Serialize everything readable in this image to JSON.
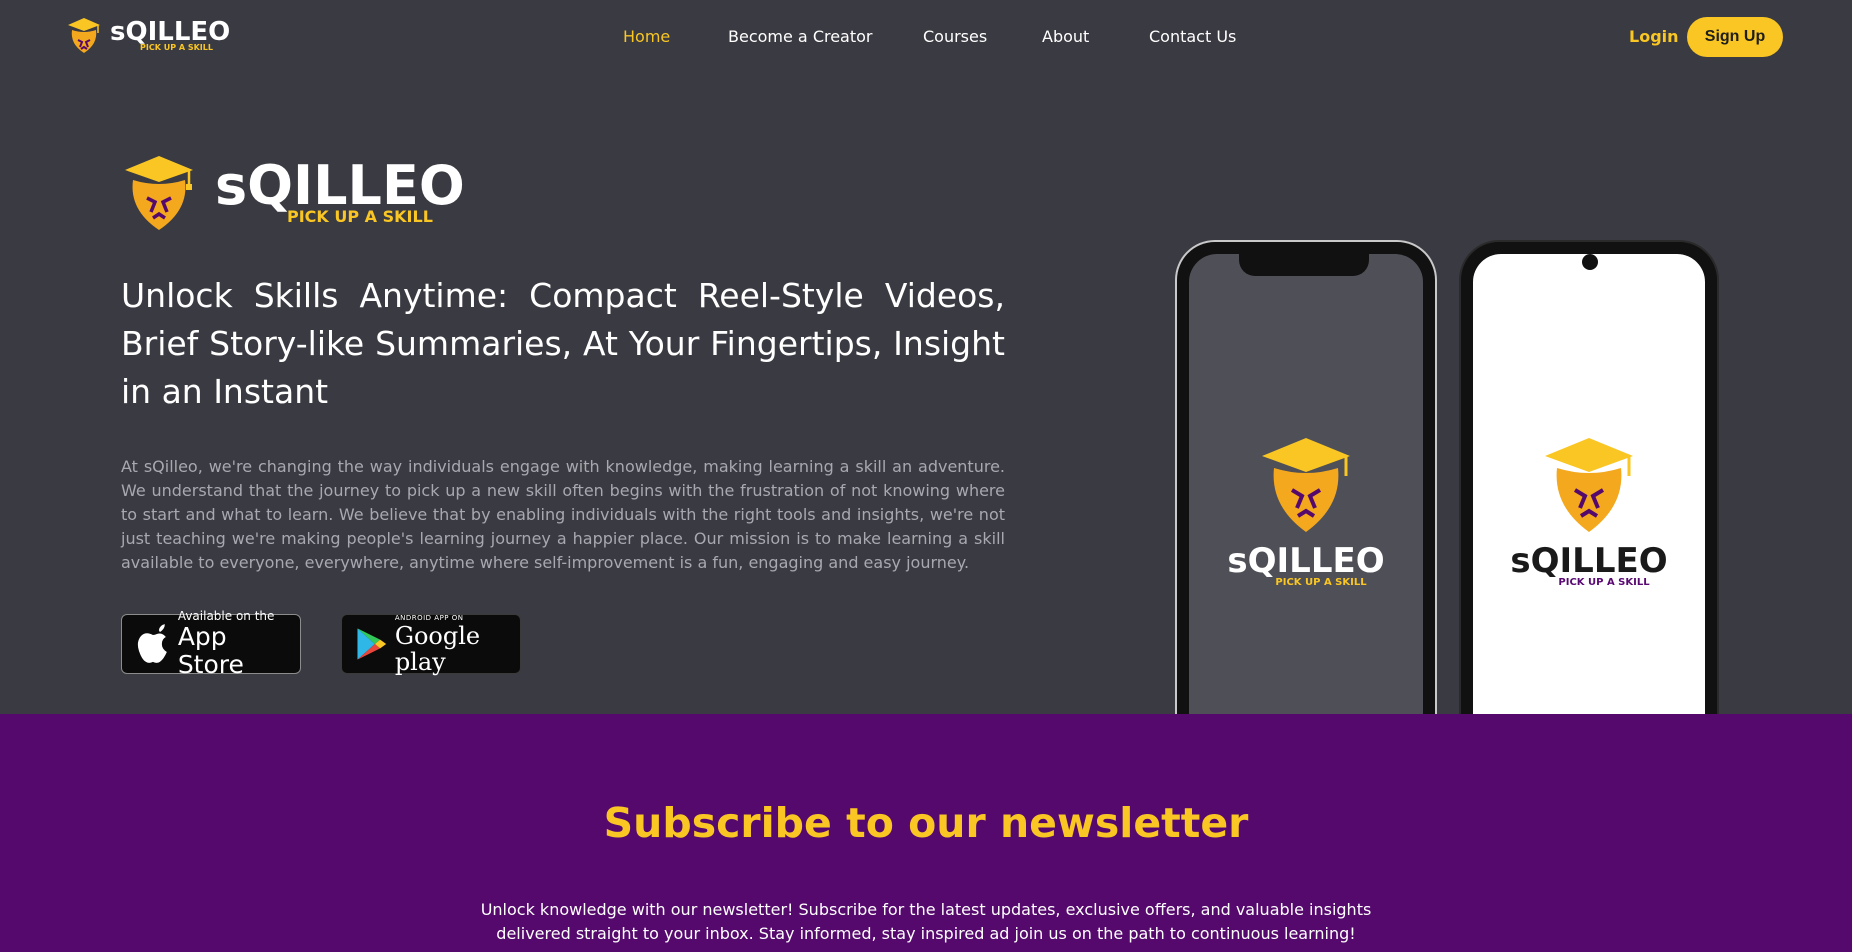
{
  "header": {
    "brand": {
      "wordmark": "sQILLEO",
      "tagline": "PICK UP A SKILL"
    },
    "nav": [
      {
        "label": "Home",
        "active": true
      },
      {
        "label": "Become a Creator",
        "active": false
      },
      {
        "label": "Courses",
        "active": false
      },
      {
        "label": "About",
        "active": false
      },
      {
        "label": "Contact Us",
        "active": false
      }
    ],
    "login_label": "Login",
    "signup_label": "Sign Up"
  },
  "hero": {
    "logo": {
      "wordmark": "sQILLEO",
      "tagline": "PICK UP A SKILL"
    },
    "headline": "Unlock Skills Anytime: Compact Reel-Style Videos, Brief Story-like Summaries, At Your Fingertips, Insight in an Instant",
    "description": "At sQilleo, we're changing the way individuals engage with knowledge, making learning a skill an adventure. We understand that the journey to pick up a new skill often begins with the frustration of not knowing where to start and what to learn. We believe that by enabling individuals with the right tools and insights, we're not just teaching we're making people's learning journey a happier place. Our mission is to make learning a skill available to everyone, everywhere, anytime where self-improvement is a fun, engaging and easy journey.",
    "app_store": {
      "small": "Available on the",
      "big": "App Store"
    },
    "google_play": {
      "small": "ANDROID APP ON",
      "big": "Google play"
    },
    "phones": {
      "left": {
        "wordmark": "sQILLEO",
        "tagline": "PICK UP A SKILL"
      },
      "right": {
        "wordmark": "sQILLEO",
        "tagline": "PICK UP A SKILL"
      }
    }
  },
  "newsletter": {
    "title": "Subscribe to our newsletter",
    "text": "Unlock knowledge with our newsletter! Subscribe for the latest updates, exclusive offers, and valuable insights delivered straight to your inbox. Stay informed, stay inspired ad join us on the path to continuous learning!"
  },
  "colors": {
    "background": "#3a3a42",
    "accent": "#f9c623",
    "newsletter_bg": "#55096d",
    "muted_text": "#a8a8b0"
  },
  "icons": {
    "brand": "lion-graduation-cap-icon",
    "apple": "apple-icon",
    "play": "google-play-icon"
  }
}
